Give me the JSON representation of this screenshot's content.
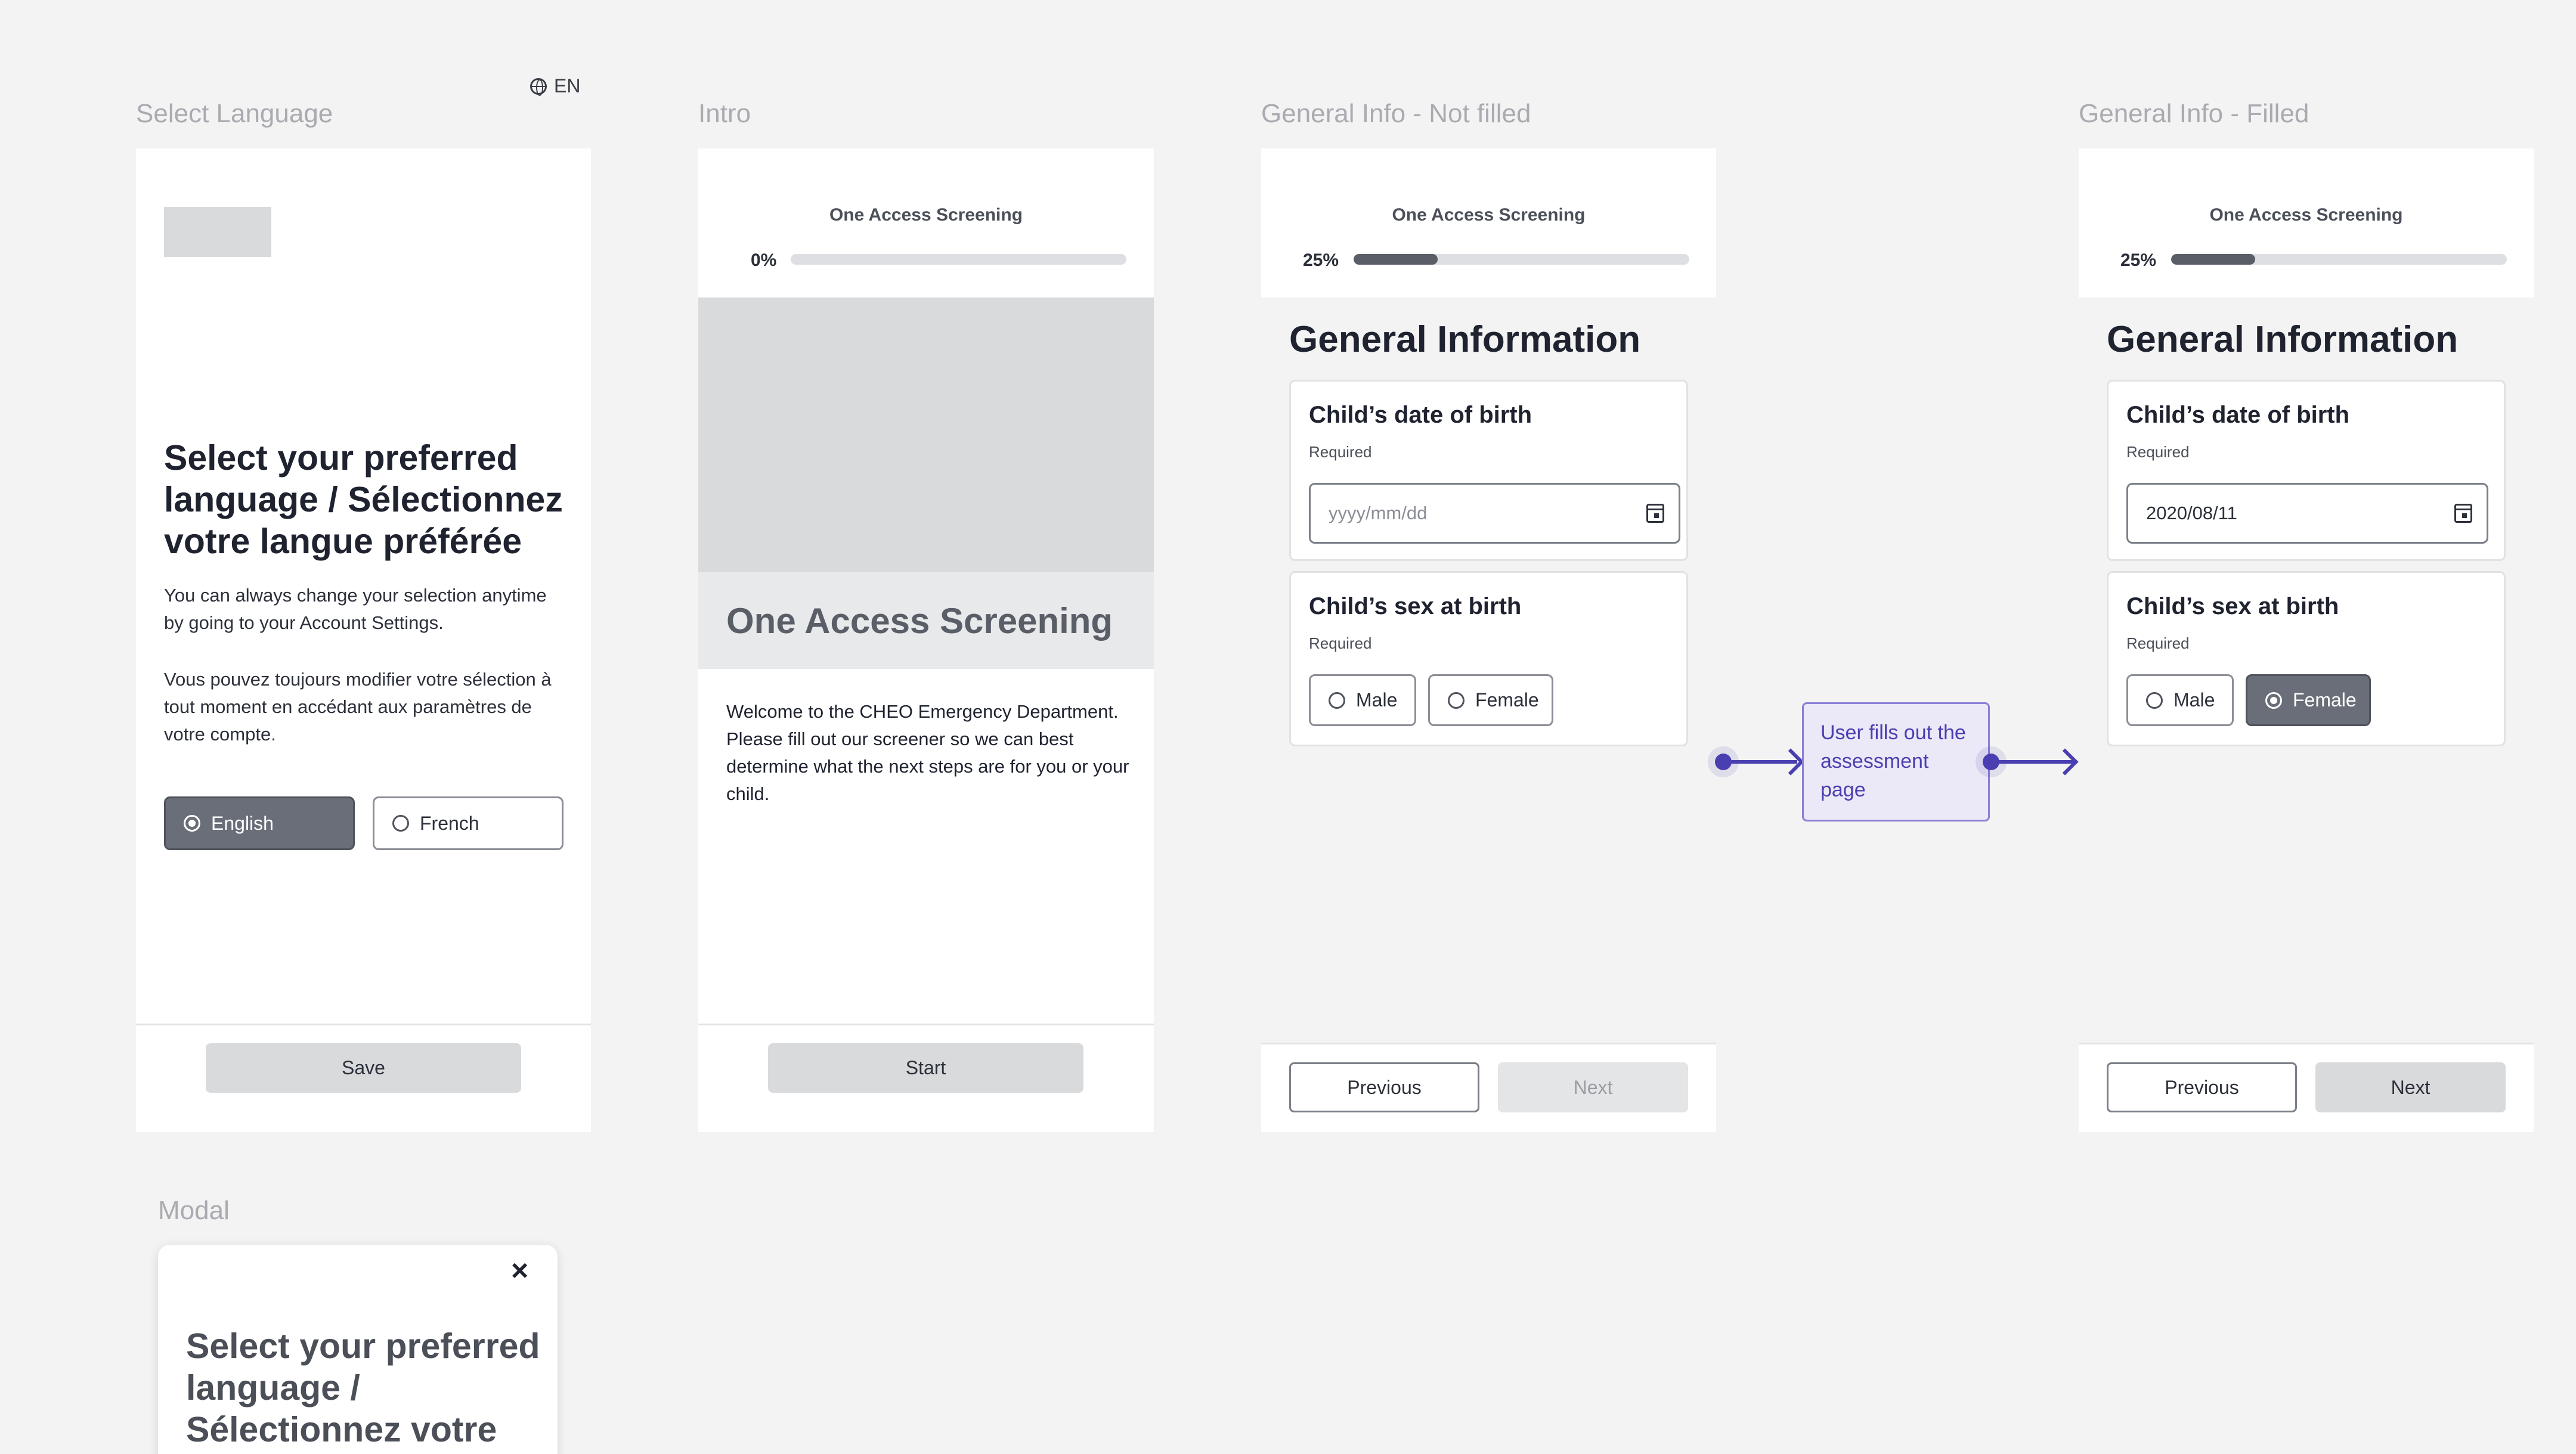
{
  "frames": {
    "select_language": "Select Language",
    "intro": "Intro",
    "general_not_filled": "General Info - Not filled",
    "general_filled": "General Info - Filled",
    "modal": "Modal"
  },
  "language_indicator": "EN",
  "select_language_screen": {
    "heading": "Select your preferred language / Sélectionnez votre langue préférée",
    "text_en": "You can always change your selection anytime by going to your Account Settings.",
    "text_fr": "Vous pouvez toujours modifier votre sélection à tout moment en accédant aux paramètres de votre compte.",
    "options": [
      "English",
      "French"
    ],
    "selected": "English",
    "save_label": "Save"
  },
  "intro_screen": {
    "header_title": "One Access Screening",
    "progress_label": "0%",
    "progress": 0,
    "hero_title": "One Access Screening",
    "welcome_text": "Welcome to the CHEO Emergency Department. Please fill out our screener so we can best determine what the next steps are for you or your child.",
    "start_label": "Start"
  },
  "general_not_filled": {
    "header_title": "One Access Screening",
    "progress_label": "25%",
    "progress": 0.25,
    "title": "General Information",
    "dob_label": "Child’s date of birth",
    "dob_required": "Required",
    "dob_placeholder": "yyyy/mm/dd",
    "sex_label": "Child’s sex at birth",
    "sex_required": "Required",
    "sex_options": [
      "Male",
      "Female"
    ],
    "previous_label": "Previous",
    "next_label": "Next"
  },
  "annotation": {
    "text": "User fills out the assessment page",
    "color": "#4a3fb0"
  },
  "general_filled": {
    "header_title": "One Access Screening",
    "progress_label": "25%",
    "progress": 0.25,
    "title": "General Information",
    "dob_label": "Child’s date of birth",
    "dob_required": "Required",
    "dob_value": "2020/08/11",
    "sex_label": "Child’s sex at birth",
    "sex_required": "Required",
    "sex_options": [
      "Male",
      "Female"
    ],
    "sex_selected": "Female",
    "previous_label": "Previous",
    "next_label": "Next"
  },
  "modal": {
    "heading": "Select your preferred language / Sélectionnez votre",
    "close_icon": "close-icon"
  }
}
